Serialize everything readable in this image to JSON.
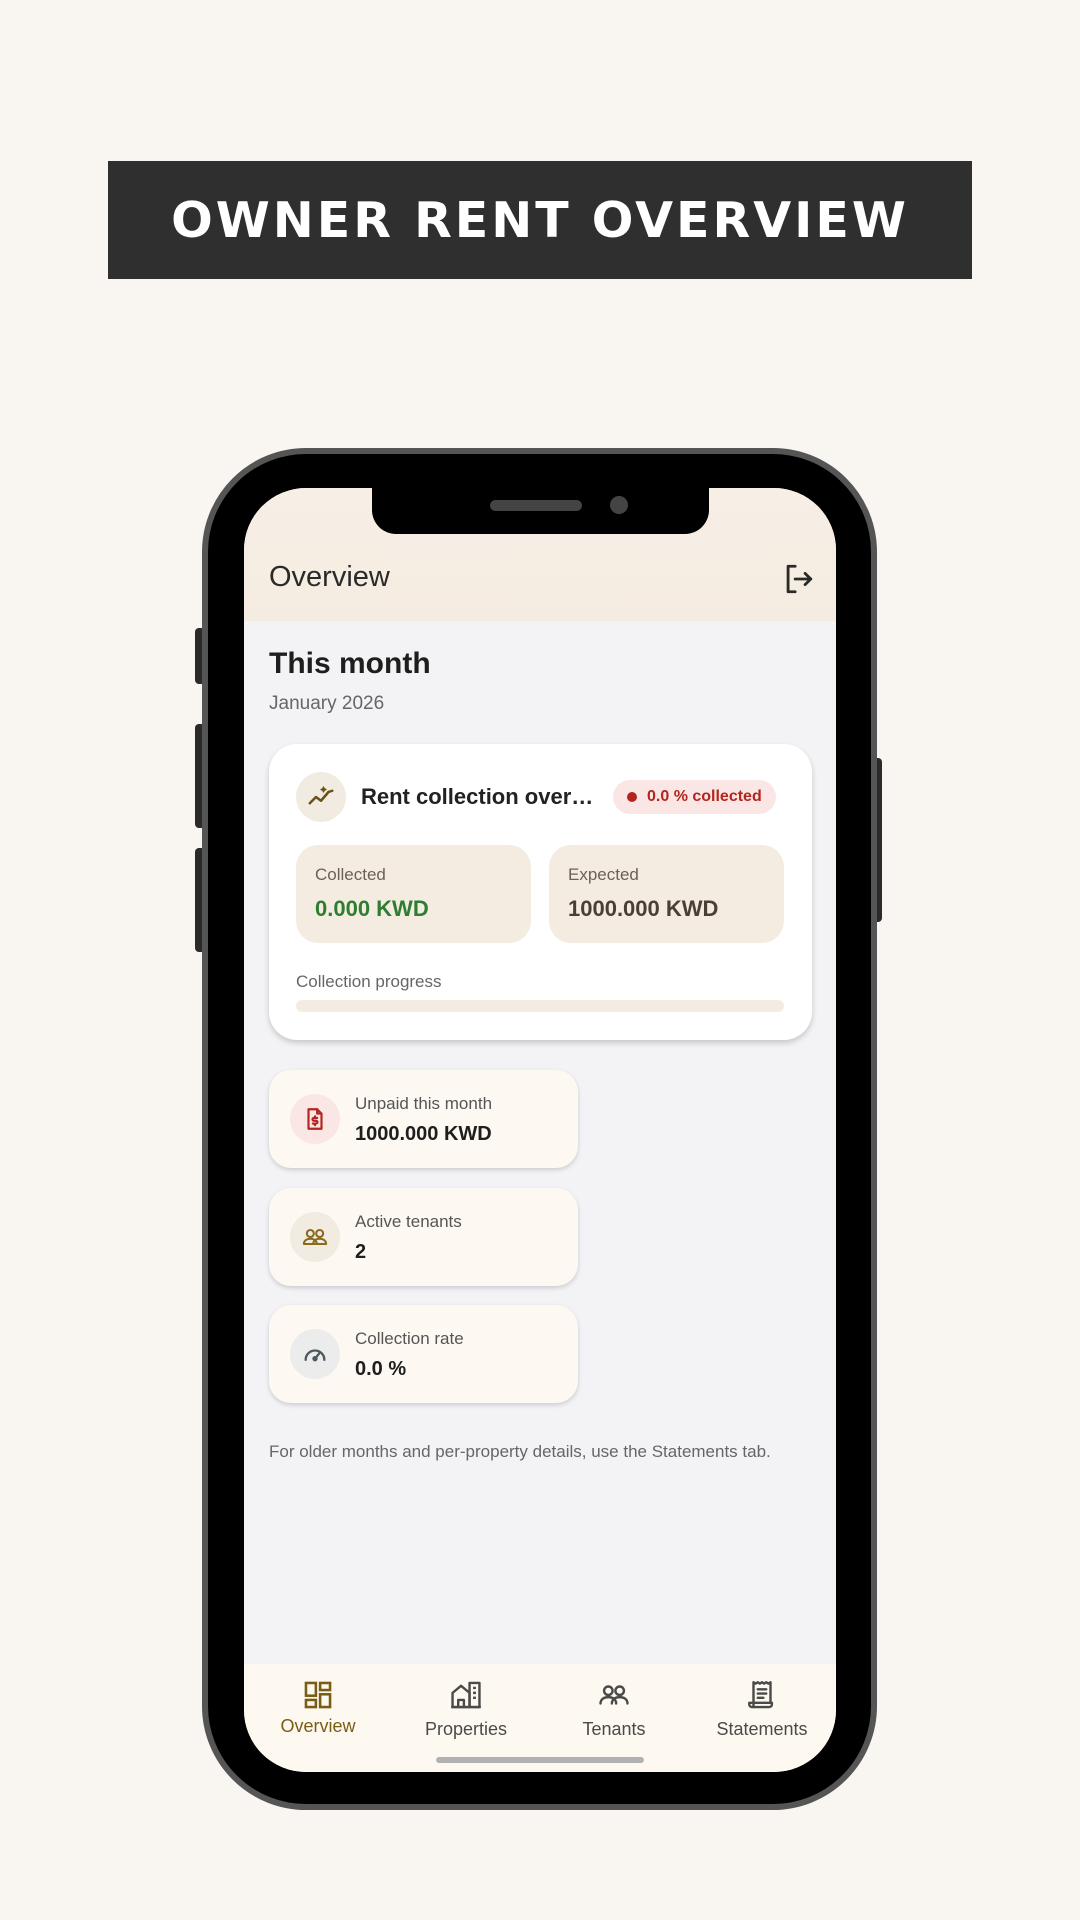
{
  "banner": {
    "title": "OWNER RENT OVERVIEW"
  },
  "appbar": {
    "title": "Overview",
    "logout_icon": "logout-icon"
  },
  "header": {
    "title": "This month",
    "subtitle": "January 2026"
  },
  "overview_card": {
    "title": "Rent collection overvi…",
    "badge": "0.0 % collected",
    "collected": {
      "label": "Collected",
      "value": "0.000 KWD",
      "color": "#2e7d32"
    },
    "expected": {
      "label": "Expected",
      "value": "1000.000 KWD",
      "color": "#4a3f35"
    },
    "progress_label": "Collection progress",
    "progress_fraction": 0.0
  },
  "stats": [
    {
      "label": "Unpaid this month",
      "value": "1000.000 KWD",
      "icon": "invoice-dollar-icon",
      "icon_bg": "#fbe6e6",
      "icon_color": "#b3261e"
    },
    {
      "label": "Active tenants",
      "value": "2",
      "icon": "people-icon",
      "icon_bg": "#f1ebe2",
      "icon_color": "#8a6a1f"
    },
    {
      "label": "Collection rate",
      "value": "0.0 %",
      "icon": "speedometer-icon",
      "icon_bg": "#ececec",
      "icon_color": "#4a5a5e"
    }
  ],
  "footer_note": "For older months and per-property details, use the Statements tab.",
  "nav": [
    {
      "label": "Overview",
      "icon": "dashboard-icon",
      "active": true
    },
    {
      "label": "Properties",
      "icon": "building-icon",
      "active": false
    },
    {
      "label": "Tenants",
      "icon": "people-icon",
      "active": false
    },
    {
      "label": "Statements",
      "icon": "receipt-icon",
      "active": false
    }
  ],
  "colors": {
    "accent": "#7a5d14",
    "danger": "#b3261e",
    "success": "#2e7d32"
  }
}
